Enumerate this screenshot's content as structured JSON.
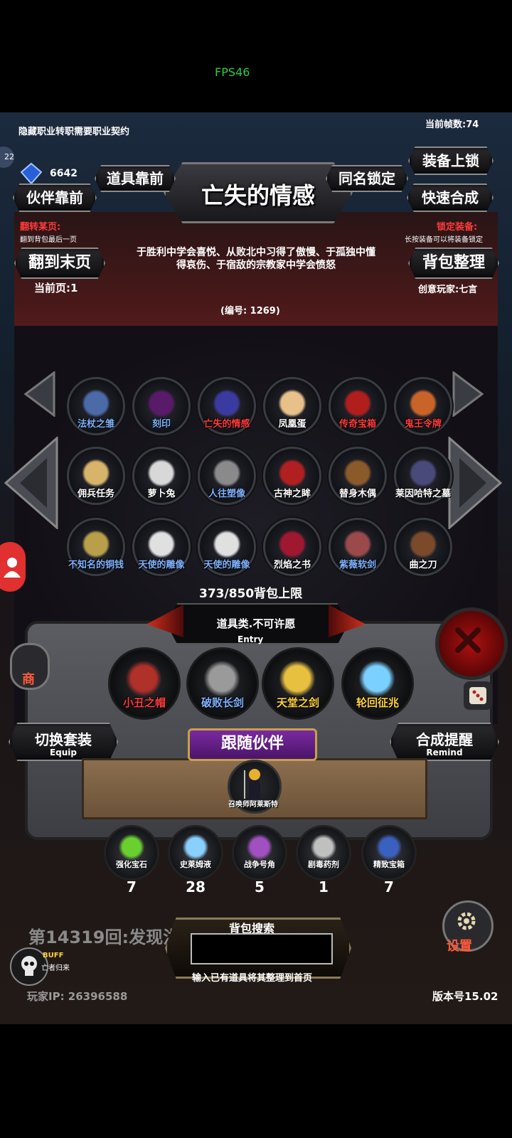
{
  "status": {
    "fps": "FPS46"
  },
  "top_info": {
    "hidden_class_text": "隐藏职业转职需要职业契约",
    "frame_count": "当前帧数:74",
    "gem_count": "6642",
    "level_badge": "22"
  },
  "top_buttons": {
    "item_front": "道具靠前",
    "same_name_lock": "同名锁定",
    "equip_lock": "装备上锁",
    "partner_front": "伙伴靠前",
    "quick_compose": "快速合成"
  },
  "detail": {
    "title": "亡失的情感",
    "flip_label": "翻转某页:",
    "flip_desc": "翻到背包最后一页",
    "lock_label": "锁定装备:",
    "lock_desc": "长按装备可以将装备锁定",
    "desc_line1": "于胜利中学会喜悦、从败北中习得了傲慢、于孤独中懂",
    "desc_line2": "得哀伤、于宿敌的宗教家中学会愤怒",
    "number": "(编号:  1269)",
    "creator": "创意玩家:七言"
  },
  "page_controls": {
    "to_last_page": "翻到末页",
    "current_page": "当前页:1",
    "sort_bag": "背包整理"
  },
  "bag_items": [
    {
      "label": "法杖之雏",
      "color": "#7fb2ff",
      "icon": "staff-icon",
      "tint": "#4a6aa8"
    },
    {
      "label": "刻印",
      "color": "#7fb2ff",
      "icon": "seal-orb-icon",
      "tint": "#5a1a6a"
    },
    {
      "label": "亡失的情感",
      "color": "#ff3b3b",
      "icon": "mask-icon",
      "tint": "#3a3aa0"
    },
    {
      "label": "凤凰蛋",
      "color": "#ffffff",
      "icon": "egg-icon",
      "tint": "#e8c08a"
    },
    {
      "label": "传奇宝箱",
      "color": "#ff3b3b",
      "icon": "chest-icon",
      "tint": "#b01e1e"
    },
    {
      "label": "鬼王令牌",
      "color": "#ff3b3b",
      "icon": "card-icon",
      "tint": "#c8642a"
    },
    {
      "label": "佣兵任务",
      "color": "#ffffff",
      "icon": "scroll-icon",
      "tint": "#d8b46a"
    },
    {
      "label": "萝卜兔",
      "color": "#ffffff",
      "icon": "rabbit-icon",
      "tint": "#d8d8d8"
    },
    {
      "label": "人往塑像",
      "color": "#7fb2ff",
      "icon": "statue-icon",
      "tint": "#8a8a8a"
    },
    {
      "label": "古神之眸",
      "color": "#ffffff",
      "icon": "eye-icon",
      "tint": "#b02020"
    },
    {
      "label": "替身木偶",
      "color": "#ffffff",
      "icon": "puppet-icon",
      "tint": "#8a5a2a"
    },
    {
      "label": "莱因哈特之墓",
      "color": "#ffffff",
      "icon": "tomb-icon",
      "tint": "#4a4a7a"
    },
    {
      "label": "不知名的铜钱",
      "color": "#7fb2ff",
      "icon": "coin-icon",
      "tint": "#b8a04a"
    },
    {
      "label": "天使的雕像",
      "color": "#7fb2ff",
      "icon": "angel-statue-icon",
      "tint": "#e0e0e0"
    },
    {
      "label": "天使的雕像",
      "color": "#7fb2ff",
      "icon": "angel-statue-icon",
      "tint": "#e0e0e0"
    },
    {
      "label": "烈焰之书",
      "color": "#ffffff",
      "icon": "book-icon",
      "tint": "#a01830"
    },
    {
      "label": "紫薇软剑",
      "color": "#7fb2ff",
      "icon": "whip-sword-icon",
      "tint": "#9a4a4a"
    },
    {
      "label": "曲之刀",
      "color": "#ffffff",
      "icon": "curved-blade-icon",
      "tint": "#7a4a2a"
    }
  ],
  "bag_capacity": "373/850背包上限",
  "entry": {
    "category": "道具类.不可许愿",
    "caption": "Entry",
    "items": [
      {
        "label": "小丑之帽",
        "color": "#ff3b3b",
        "icon": "jester-hat-icon",
        "tint": "#b0302a"
      },
      {
        "label": "破败长剑",
        "color": "#7fb2ff",
        "icon": "ruined-sword-icon",
        "tint": "#9a9a9a"
      },
      {
        "label": "天堂之剑",
        "color": "#ffd23b",
        "icon": "heaven-sword-icon",
        "tint": "#e8c040"
      },
      {
        "label": "轮回征兆",
        "color": "#ffd23b",
        "icon": "ice-staff-icon",
        "tint": "#7ad0ff"
      }
    ]
  },
  "switch_set": {
    "label": "切换套装",
    "sub": "Equip"
  },
  "compose_remind": {
    "label": "合成提醒",
    "sub": "Remind"
  },
  "follow_partner": {
    "title": "跟随伙伴",
    "name": "召唤师阿莱斯特"
  },
  "consumables": [
    {
      "label": "强化宝石",
      "count": "7",
      "icon": "green-gem-icon",
      "tint": "#6ad030"
    },
    {
      "label": "史莱姆液",
      "count": "28",
      "icon": "potion-icon",
      "tint": "#8ad0ff"
    },
    {
      "label": "战争号角",
      "count": "5",
      "icon": "horn-icon",
      "tint": "#a050c0"
    },
    {
      "label": "剧毒药剂",
      "count": "1",
      "icon": "poison-icon",
      "tint": "#c0c0c0"
    },
    {
      "label": "精致宝箱",
      "count": "7",
      "icon": "blue-chest-icon",
      "tint": "#3a60c0"
    }
  ],
  "bottom": {
    "round_text": "第14319回:发现洪",
    "search_title": "背包搜索",
    "search_hint": "输入已有道具将其整理到首页",
    "buff": "BUFF",
    "buff_sub": "亡者归来",
    "player_ip": "玩家IP:  26396588",
    "version": "版本号15.02",
    "settings": "设置",
    "shop": "商"
  }
}
